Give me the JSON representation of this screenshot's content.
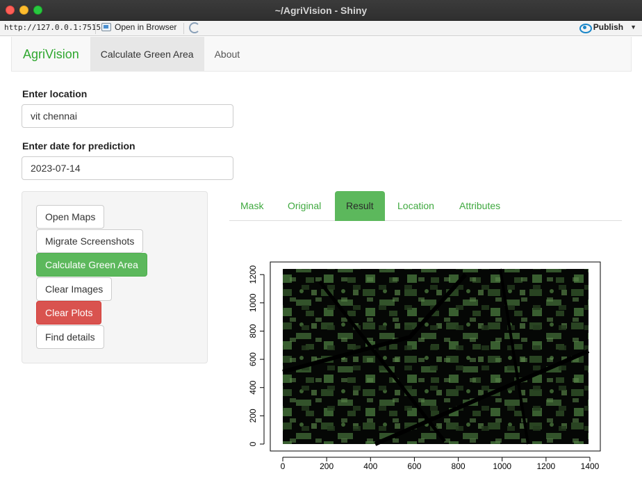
{
  "window": {
    "title": "~/AgriVision - Shiny"
  },
  "toolbar": {
    "url": "http://127.0.0.1:7515",
    "open_in_browser": "Open in Browser",
    "publish": "Publish"
  },
  "navbar": {
    "brand": "AgriVision",
    "items": [
      {
        "label": "Calculate Green Area",
        "active": true
      },
      {
        "label": "About",
        "active": false
      }
    ]
  },
  "form": {
    "location_label": "Enter location",
    "location_value": "vit chennai",
    "date_label": "Enter date for prediction",
    "date_value": "2023-07-14"
  },
  "sidebar": {
    "buttons": [
      {
        "label": "Open Maps",
        "style": "default"
      },
      {
        "label": "Migrate Screenshots",
        "style": "default"
      },
      {
        "label": "Calculate Green Area",
        "style": "success"
      },
      {
        "label": "Clear Images",
        "style": "default"
      },
      {
        "label": "Clear Plots",
        "style": "danger"
      },
      {
        "label": "Find details",
        "style": "default"
      }
    ]
  },
  "tabs": [
    {
      "label": "Mask",
      "active": false
    },
    {
      "label": "Original",
      "active": false
    },
    {
      "label": "Result",
      "active": true
    },
    {
      "label": "Location",
      "active": false
    },
    {
      "label": "Attributes",
      "active": false
    }
  ],
  "plot": {
    "x_ticks": [
      "0",
      "200",
      "400",
      "600",
      "800",
      "1000",
      "1200",
      "1400"
    ],
    "y_ticks": [
      "0",
      "200",
      "400",
      "600",
      "800",
      "1000",
      "1200"
    ],
    "x_range": [
      0,
      1400
    ],
    "y_range": [
      0,
      1250
    ],
    "image": "masked green area satellite image"
  },
  "colors": {
    "brand": "#2fa72f",
    "success": "#5cb85c",
    "danger": "#d9534f"
  }
}
